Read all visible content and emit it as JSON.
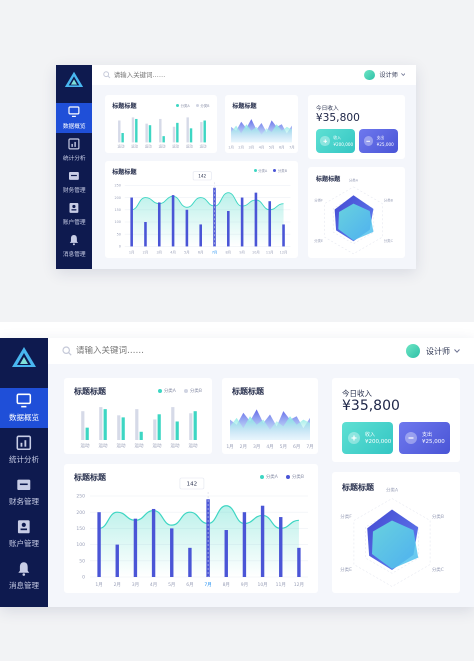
{
  "nav": [
    {
      "label": "数据概览",
      "icon": "monitor-icon",
      "active": true
    },
    {
      "label": "统计分析",
      "icon": "chart-icon",
      "active": false
    },
    {
      "label": "财务管理",
      "icon": "wallet-icon",
      "active": false
    },
    {
      "label": "账户管理",
      "icon": "user-card-icon",
      "active": false
    },
    {
      "label": "消息管理",
      "icon": "bell-icon",
      "active": false
    }
  ],
  "search": {
    "placeholder": "请输入关键词……"
  },
  "user": {
    "name": "设计师"
  },
  "card1": {
    "title": "标题标题",
    "legend": [
      "分类A",
      "分类B"
    ]
  },
  "card2": {
    "title": "标题标题"
  },
  "card3": {
    "title": "今日收入",
    "amount": "¥35,800",
    "income": {
      "label": "收入",
      "value": "¥200,000"
    },
    "expense": {
      "label": "支出",
      "value": "¥25,000"
    }
  },
  "card4": {
    "title": "标题标题",
    "legend": [
      "分类A",
      "分类B"
    ],
    "tooltip": "142"
  },
  "card5": {
    "title": "标题标题",
    "axes": [
      "分类A",
      "分类B",
      "分类C",
      "分类D",
      "分类E",
      "分类F"
    ]
  },
  "colors": {
    "sidebar": "#0e1a4f",
    "accent": "#1f4fd8",
    "teal": "#3dd6c3",
    "indigo": "#4a55d6"
  },
  "chart_data": [
    {
      "type": "bar",
      "categories": [
        "运动",
        "运动",
        "运动",
        "运动",
        "运动",
        "运动",
        "运动"
      ],
      "series": [
        {
          "name": "分类A",
          "values": [
            12,
            30,
            22,
            8,
            25,
            18,
            28
          ]
        },
        {
          "name": "分类B",
          "values": [
            28,
            32,
            24,
            30,
            20,
            32,
            26
          ]
        }
      ]
    },
    {
      "type": "area",
      "categories": [
        "1月",
        "2月",
        "3月",
        "4月",
        "5月",
        "6月",
        "7月"
      ],
      "series": [
        {
          "values": [
            60,
            45,
            80,
            55,
            90,
            50,
            75,
            40,
            85,
            60,
            70,
            35,
            65
          ]
        },
        {
          "values": [
            40,
            65,
            35,
            70,
            45,
            60,
            30,
            55,
            40,
            70,
            45,
            60,
            50
          ]
        }
      ]
    },
    {
      "type": "bar",
      "categories": [
        "1月",
        "2月",
        "3月",
        "4月",
        "5月",
        "6月",
        "7月",
        "8月",
        "9月",
        "10月",
        "11月",
        "12月"
      ],
      "ylim": [
        0,
        250
      ],
      "yticks": [
        0,
        50,
        100,
        150,
        200,
        250
      ],
      "highlight": "7月",
      "series": [
        {
          "name": "分类A",
          "type": "line",
          "values": [
            150,
            200,
            175,
            205,
            160,
            200,
            165,
            220,
            165,
            190,
            150,
            175
          ]
        },
        {
          "name": "分类B",
          "type": "bar",
          "values": [
            200,
            100,
            180,
            210,
            150,
            90,
            240,
            145,
            200,
            220,
            185,
            90
          ]
        }
      ]
    },
    {
      "type": "radar",
      "axes": [
        "分类A",
        "分类B",
        "分类C",
        "分类D",
        "分类E",
        "分类F"
      ],
      "series": [
        {
          "values": [
            60,
            55,
            45,
            50,
            48,
            52
          ]
        },
        {
          "values": [
            40,
            45,
            55,
            48,
            42,
            40
          ]
        }
      ]
    }
  ]
}
